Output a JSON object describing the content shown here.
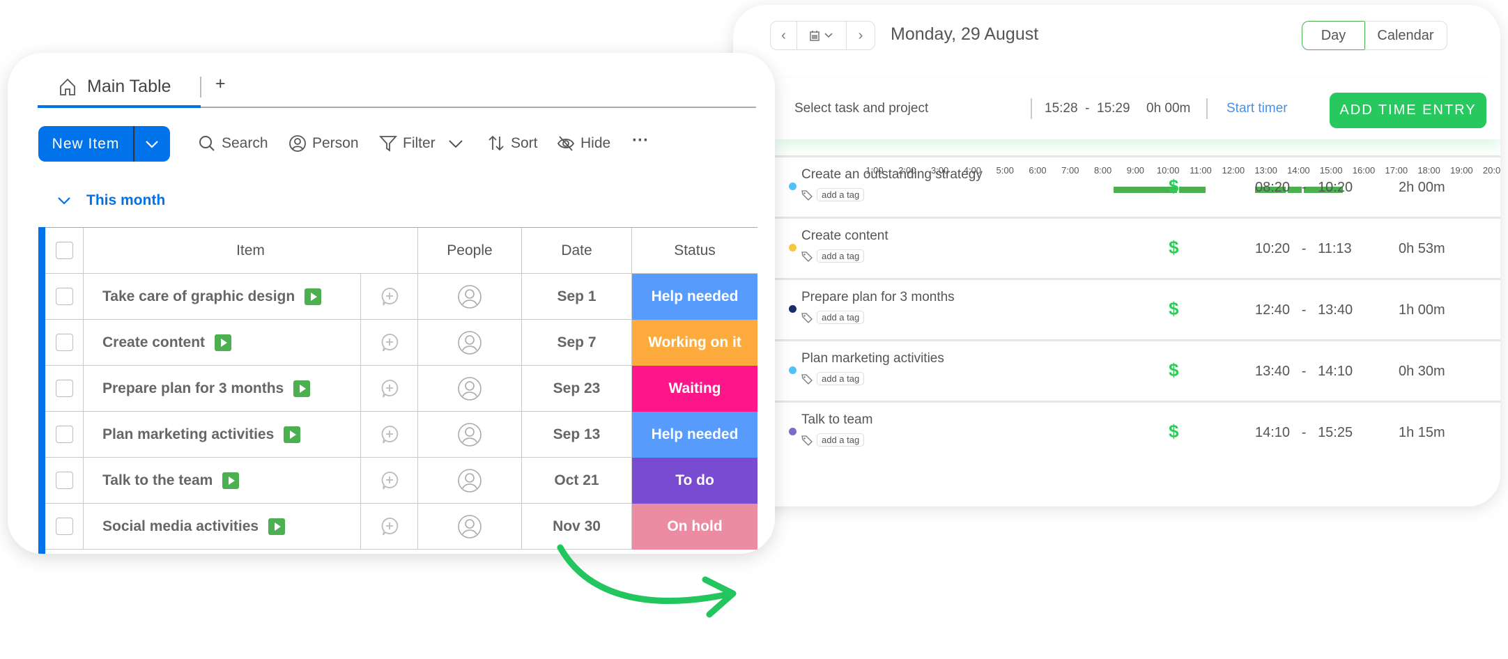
{
  "board": {
    "tab_label": "Main Table",
    "add_tab": "+",
    "new_item": "New Item",
    "toolbar": {
      "search": "Search",
      "person": "Person",
      "filter": "Filter",
      "sort": "Sort",
      "hide": "Hide",
      "more": "···"
    },
    "group": "This month",
    "columns": {
      "item": "Item",
      "people": "People",
      "date": "Date",
      "status": "Status"
    },
    "rows": [
      {
        "item": "Take care of graphic design",
        "date": "Sep 1",
        "status": "Help needed",
        "status_color": "#579bfc"
      },
      {
        "item": "Create content",
        "date": "Sep 7",
        "status": "Working on it",
        "status_color": "#fdab3d"
      },
      {
        "item": "Prepare plan for 3 months",
        "date": "Sep 23",
        "status": "Waiting",
        "status_color": "#ff158a"
      },
      {
        "item": "Plan marketing activities",
        "date": "Sep 13",
        "status": "Help needed",
        "status_color": "#579bfc"
      },
      {
        "item": "Talk to the team",
        "date": "Oct 21",
        "status": "To do",
        "status_color": "#784bd1"
      },
      {
        "item": "Social media activities",
        "date": "Nov 30",
        "status": "On hold",
        "status_color": "#ec8ca2"
      }
    ],
    "accent": "#0073ea"
  },
  "tracker": {
    "date_title": "Monday, 29 August",
    "view_day": "Day",
    "view_calendar": "Calendar",
    "entry": {
      "placeholder": "Select task and project",
      "start": "15:28",
      "end": "15:29",
      "duration": "0h 00m",
      "start_timer": "Start timer",
      "add_button": "ADD TIME ENTRY"
    },
    "hours": [
      "1:00",
      "2:00",
      "3:00",
      "4:00",
      "5:00",
      "6:00",
      "7:00",
      "8:00",
      "9:00",
      "10:00",
      "11:00",
      "12:00",
      "13:00",
      "14:00",
      "15:00",
      "16:00",
      "17:00",
      "18:00",
      "19:00",
      "20:00"
    ],
    "entries": [
      {
        "title": "Create an outstanding strategy",
        "tag": "add a tag",
        "billable": "$",
        "start": "08:20",
        "end": "10:20",
        "duration": "2h 00m",
        "color": "#4fc3f7"
      },
      {
        "title": "Create content",
        "tag": "add a tag",
        "billable": "$",
        "start": "10:20",
        "end": "11:13",
        "duration": "0h 53m",
        "color": "#f5c842"
      },
      {
        "title": "Prepare plan for 3 months",
        "tag": "add a tag",
        "billable": "$",
        "start": "12:40",
        "end": "13:40",
        "duration": "1h 00m",
        "color": "#1a2e6b"
      },
      {
        "title": "Plan marketing activities",
        "tag": "add a tag",
        "billable": "$",
        "start": "13:40",
        "end": "14:10",
        "duration": "0h 30m",
        "color": "#4fc3f7"
      },
      {
        "title": "Talk to team",
        "tag": "add a tag",
        "billable": "$",
        "start": "14:10",
        "end": "15:25",
        "duration": "1h 15m",
        "color": "#7e6bc9"
      }
    ],
    "accent": "#27c95f"
  }
}
